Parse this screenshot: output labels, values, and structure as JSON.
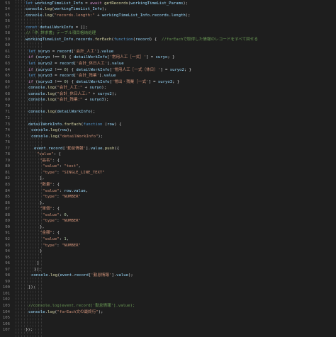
{
  "editor": {
    "background": "#1e1e1e",
    "colors": {
      "plain": "#d4d4d4",
      "keyword": "#569cd6",
      "control": "#c586c0",
      "function": "#dcdcaa",
      "variable": "#9cdcfe",
      "string": "#ce9178",
      "number": "#b5cea8",
      "comment": "#6a9955",
      "object": "#4ec9b0",
      "line_number": "#858585"
    },
    "lines": [
      {
        "n": "53",
        "indent": 4,
        "tokens": [
          [
            "kw",
            "let "
          ],
          [
            "var",
            "workingTimeList_Info"
          ],
          [
            "plain",
            " = "
          ],
          [
            "ctl",
            "await "
          ],
          [
            "fn",
            "getRecords"
          ],
          [
            "plain",
            "("
          ],
          [
            "var",
            "workingTimeList_Params"
          ],
          [
            "plain",
            ");"
          ]
        ]
      },
      {
        "n": "54",
        "indent": 4,
        "tokens": [
          [
            "var",
            "console"
          ],
          [
            "plain",
            "."
          ],
          [
            "fn",
            "log"
          ],
          [
            "plain",
            "("
          ],
          [
            "var",
            "workingTimeList_Info"
          ],
          [
            "plain",
            ");"
          ]
        ]
      },
      {
        "n": "55",
        "indent": 4,
        "tokens": [
          [
            "var",
            "console"
          ],
          [
            "plain",
            "."
          ],
          [
            "fn",
            "log"
          ],
          [
            "plain",
            "("
          ],
          [
            "str",
            "\"records.length:\""
          ],
          [
            "plain",
            " + "
          ],
          [
            "var",
            "workingTimeList_Info"
          ],
          [
            "plain",
            "."
          ],
          [
            "var",
            "records"
          ],
          [
            "plain",
            "."
          ],
          [
            "var",
            "length"
          ],
          [
            "plain",
            ");"
          ]
        ]
      },
      {
        "n": "56",
        "indent": 0,
        "tokens": []
      },
      {
        "n": "57",
        "indent": 4,
        "tokens": [
          [
            "kw",
            "const "
          ],
          [
            "var",
            "detailWorkInfo"
          ],
          [
            "plain",
            " = [];"
          ]
        ]
      },
      {
        "n": "58",
        "indent": 4,
        "tokens": [
          [
            "cmt",
            "//「作_詳求書」テーブル項目格納処理"
          ]
        ]
      },
      {
        "n": "59",
        "indent": 4,
        "tokens": [
          [
            "var",
            "workingTimeList_Info"
          ],
          [
            "plain",
            "."
          ],
          [
            "var",
            "records"
          ],
          [
            "plain",
            "."
          ],
          [
            "fn",
            "forEach"
          ],
          [
            "plain",
            "("
          ],
          [
            "kw",
            "function"
          ],
          [
            "plain",
            "("
          ],
          [
            "var",
            "record"
          ],
          [
            "plain",
            ") {  "
          ],
          [
            "cmt",
            "//forEachで取得した情報のレコードをすべて回せる"
          ]
        ]
      },
      {
        "n": "60",
        "indent": 0,
        "tokens": []
      },
      {
        "n": "61",
        "indent": 5,
        "tokens": [
          [
            "kw",
            "let "
          ],
          [
            "var",
            "suryo"
          ],
          [
            "plain",
            " = "
          ],
          [
            "var",
            "record"
          ],
          [
            "plain",
            "["
          ],
          [
            "str",
            "'会計_人工'"
          ],
          [
            "plain",
            "]."
          ],
          [
            "var",
            "value"
          ]
        ]
      },
      {
        "n": "62",
        "indent": 5,
        "tokens": [
          [
            "ctl",
            "if "
          ],
          [
            "plain",
            "("
          ],
          [
            "var",
            "suryo"
          ],
          [
            "plain",
            " !== "
          ],
          [
            "num",
            "0"
          ],
          [
            "plain",
            ") { "
          ],
          [
            "var",
            "detailWorkInfo"
          ],
          [
            "plain",
            "["
          ],
          [
            "str",
            "'常用人工［一式］'"
          ],
          [
            "plain",
            "] = "
          ],
          [
            "var",
            "suryo"
          ],
          [
            "plain",
            "; }"
          ]
        ]
      },
      {
        "n": "63",
        "indent": 5,
        "tokens": [
          [
            "kw",
            "let "
          ],
          [
            "var",
            "suryo2"
          ],
          [
            "plain",
            " = "
          ],
          [
            "var",
            "record"
          ],
          [
            "plain",
            "["
          ],
          [
            "str",
            "'会計_休日人工'"
          ],
          [
            "plain",
            "]."
          ],
          [
            "var",
            "value"
          ]
        ]
      },
      {
        "n": "64",
        "indent": 5,
        "tokens": [
          [
            "ctl",
            "if "
          ],
          [
            "plain",
            "("
          ],
          [
            "var",
            "suryo2"
          ],
          [
            "plain",
            " !== "
          ],
          [
            "num",
            "0"
          ],
          [
            "plain",
            ") { "
          ],
          [
            "var",
            "detailWorkInfo"
          ],
          [
            "plain",
            "["
          ],
          [
            "str",
            "'常用人工［一式（休日）'"
          ],
          [
            "plain",
            "] = "
          ],
          [
            "var",
            "suryo2"
          ],
          [
            "plain",
            "; }"
          ]
        ]
      },
      {
        "n": "65",
        "indent": 5,
        "tokens": [
          [
            "kw",
            "let "
          ],
          [
            "var",
            "suryo3"
          ],
          [
            "plain",
            " = "
          ],
          [
            "var",
            "record"
          ],
          [
            "plain",
            "["
          ],
          [
            "str",
            "'会計_残業'"
          ],
          [
            "plain",
            "]."
          ],
          [
            "var",
            "value"
          ]
        ]
      },
      {
        "n": "66",
        "indent": 5,
        "tokens": [
          [
            "ctl",
            "if "
          ],
          [
            "plain",
            "("
          ],
          [
            "var",
            "suryo3"
          ],
          [
            "plain",
            " !== "
          ],
          [
            "num",
            "0"
          ],
          [
            "plain",
            ") { "
          ],
          [
            "var",
            "detailWorkInfo"
          ],
          [
            "plain",
            "["
          ],
          [
            "str",
            "'常出・残業［一式'"
          ],
          [
            "plain",
            "] = "
          ],
          [
            "var",
            "suryo3"
          ],
          [
            "plain",
            "; }"
          ]
        ]
      },
      {
        "n": "67",
        "indent": 5,
        "tokens": [
          [
            "var",
            "console"
          ],
          [
            "plain",
            "."
          ],
          [
            "fn",
            "log"
          ],
          [
            "plain",
            "("
          ],
          [
            "str",
            "\"会計_人工:\""
          ],
          [
            "plain",
            " + "
          ],
          [
            "var",
            "suryo"
          ],
          [
            "plain",
            ");"
          ]
        ]
      },
      {
        "n": "68",
        "indent": 5,
        "tokens": [
          [
            "var",
            "console"
          ],
          [
            "plain",
            "."
          ],
          [
            "fn",
            "log"
          ],
          [
            "plain",
            "("
          ],
          [
            "str",
            "\"会計_休日人工:\""
          ],
          [
            "plain",
            " + "
          ],
          [
            "var",
            "suryo2"
          ],
          [
            "plain",
            ");"
          ]
        ]
      },
      {
        "n": "69",
        "indent": 5,
        "tokens": [
          [
            "var",
            "console"
          ],
          [
            "plain",
            "."
          ],
          [
            "fn",
            "log"
          ],
          [
            "plain",
            "("
          ],
          [
            "str",
            "\"会計_残業:\""
          ],
          [
            "plain",
            " + "
          ],
          [
            "var",
            "suryo3"
          ],
          [
            "plain",
            ");"
          ]
        ]
      },
      {
        "n": "70",
        "indent": 0,
        "tokens": []
      },
      {
        "n": "71",
        "indent": 5,
        "tokens": [
          [
            "var",
            "console"
          ],
          [
            "plain",
            "."
          ],
          [
            "fn",
            "log"
          ],
          [
            "plain",
            "("
          ],
          [
            "var",
            "detailWorkInfo"
          ],
          [
            "plain",
            ");"
          ]
        ]
      },
      {
        "n": "72",
        "indent": 0,
        "tokens": []
      },
      {
        "n": "73",
        "indent": 5,
        "tokens": [
          [
            "var",
            "detailWorkInfo"
          ],
          [
            "plain",
            "."
          ],
          [
            "fn",
            "forEach"
          ],
          [
            "plain",
            "("
          ],
          [
            "kw",
            "function "
          ],
          [
            "plain",
            "("
          ],
          [
            "var",
            "row"
          ],
          [
            "plain",
            ") {"
          ]
        ]
      },
      {
        "n": "74",
        "indent": 6,
        "tokens": [
          [
            "var",
            "console"
          ],
          [
            "plain",
            "."
          ],
          [
            "fn",
            "log"
          ],
          [
            "plain",
            "("
          ],
          [
            "var",
            "row"
          ],
          [
            "plain",
            ");"
          ]
        ]
      },
      {
        "n": "75",
        "indent": 6,
        "tokens": [
          [
            "var",
            "console"
          ],
          [
            "plain",
            "."
          ],
          [
            "fn",
            "log"
          ],
          [
            "plain",
            "("
          ],
          [
            "str",
            "\"detailWorkInfo\""
          ],
          [
            "plain",
            ");"
          ]
        ]
      },
      {
        "n": "76",
        "indent": 0,
        "tokens": []
      },
      {
        "n": "77",
        "indent": 7,
        "tokens": [
          [
            "var",
            "event"
          ],
          [
            "plain",
            "."
          ],
          [
            "var",
            "record"
          ],
          [
            "plain",
            "["
          ],
          [
            "str",
            "'勤怠情報'"
          ],
          [
            "plain",
            "]."
          ],
          [
            "var",
            "value"
          ],
          [
            "plain",
            "."
          ],
          [
            "fn",
            "push"
          ],
          [
            "plain",
            "({"
          ]
        ]
      },
      {
        "n": "78",
        "indent": 8,
        "tokens": [
          [
            "str",
            "\"value\""
          ],
          [
            "plain",
            ": {"
          ]
        ]
      },
      {
        "n": "79",
        "indent": 9,
        "tokens": [
          [
            "str",
            "\"品名\""
          ],
          [
            "plain",
            ": {"
          ]
        ]
      },
      {
        "n": "80",
        "indent": 10,
        "tokens": [
          [
            "str",
            "\"value\""
          ],
          [
            "plain",
            ": "
          ],
          [
            "str",
            "\"test\""
          ],
          [
            "plain",
            ","
          ]
        ]
      },
      {
        "n": "81",
        "indent": 10,
        "tokens": [
          [
            "str",
            "\"type\""
          ],
          [
            "plain",
            ": "
          ],
          [
            "str",
            "\"SINGLE_LINE_TEXT\""
          ]
        ]
      },
      {
        "n": "82",
        "indent": 9,
        "tokens": [
          [
            "plain",
            "},"
          ]
        ]
      },
      {
        "n": "83",
        "indent": 9,
        "tokens": [
          [
            "str",
            "\"数量\""
          ],
          [
            "plain",
            ": {"
          ]
        ]
      },
      {
        "n": "84",
        "indent": 10,
        "tokens": [
          [
            "str",
            "\"value\""
          ],
          [
            "plain",
            ": "
          ],
          [
            "var",
            "row"
          ],
          [
            "plain",
            "."
          ],
          [
            "var",
            "value"
          ],
          [
            "plain",
            ","
          ]
        ]
      },
      {
        "n": "85",
        "indent": 10,
        "tokens": [
          [
            "str",
            "\"type\""
          ],
          [
            "plain",
            ": "
          ],
          [
            "str",
            "\"NUMBER\""
          ]
        ]
      },
      {
        "n": "86",
        "indent": 9,
        "tokens": [
          [
            "plain",
            "},"
          ]
        ]
      },
      {
        "n": "87",
        "indent": 9,
        "tokens": [
          [
            "str",
            "\"単価\""
          ],
          [
            "plain",
            ": {"
          ]
        ]
      },
      {
        "n": "88",
        "indent": 10,
        "tokens": [
          [
            "str",
            "\"value\""
          ],
          [
            "plain",
            ": "
          ],
          [
            "num",
            "0"
          ],
          [
            "plain",
            ","
          ]
        ]
      },
      {
        "n": "89",
        "indent": 10,
        "tokens": [
          [
            "str",
            "\"type\""
          ],
          [
            "plain",
            ": "
          ],
          [
            "str",
            "\"NUMBER\""
          ]
        ]
      },
      {
        "n": "90",
        "indent": 9,
        "tokens": [
          [
            "plain",
            "},"
          ]
        ]
      },
      {
        "n": "91",
        "indent": 9,
        "tokens": [
          [
            "str",
            "\"金額\""
          ],
          [
            "plain",
            ": {"
          ]
        ]
      },
      {
        "n": "92",
        "indent": 10,
        "tokens": [
          [
            "str",
            "\"value\""
          ],
          [
            "plain",
            ": "
          ],
          [
            "num",
            "1"
          ],
          [
            "plain",
            ","
          ]
        ]
      },
      {
        "n": "93",
        "indent": 10,
        "tokens": [
          [
            "str",
            "\"type\""
          ],
          [
            "plain",
            ": "
          ],
          [
            "str",
            "\"NUMBER\""
          ]
        ]
      },
      {
        "n": "94",
        "indent": 9,
        "tokens": [
          [
            "plain",
            "}"
          ]
        ]
      },
      {
        "n": "95",
        "indent": 0,
        "tokens": []
      },
      {
        "n": "96",
        "indent": 8,
        "tokens": [
          [
            "plain",
            "}"
          ]
        ]
      },
      {
        "n": "97",
        "indent": 7,
        "tokens": [
          [
            "plain",
            "});"
          ]
        ]
      },
      {
        "n": "98",
        "indent": 6,
        "tokens": [
          [
            "var",
            "console"
          ],
          [
            "plain",
            "."
          ],
          [
            "fn",
            "log"
          ],
          [
            "plain",
            "("
          ],
          [
            "var",
            "event"
          ],
          [
            "plain",
            "."
          ],
          [
            "var",
            "record"
          ],
          [
            "plain",
            "["
          ],
          [
            "str",
            "'勤怠情報'"
          ],
          [
            "plain",
            "]."
          ],
          [
            "var",
            "value"
          ],
          [
            "plain",
            ");"
          ]
        ]
      },
      {
        "n": "99",
        "indent": 0,
        "tokens": []
      },
      {
        "n": "100",
        "indent": 5,
        "tokens": [
          [
            "plain",
            "});"
          ]
        ]
      },
      {
        "n": "101",
        "indent": 0,
        "tokens": []
      },
      {
        "n": "102",
        "indent": 0,
        "tokens": []
      },
      {
        "n": "103",
        "indent": 5,
        "tokens": [
          [
            "cmt",
            "//console.log(event.record['勤怠情報'].value);"
          ]
        ]
      },
      {
        "n": "104",
        "indent": 5,
        "tokens": [
          [
            "var",
            "console"
          ],
          [
            "plain",
            "."
          ],
          [
            "fn",
            "log"
          ],
          [
            "plain",
            "("
          ],
          [
            "str",
            "\"forEach文の最終行\""
          ],
          [
            "plain",
            ");"
          ]
        ]
      },
      {
        "n": "105",
        "indent": 0,
        "tokens": []
      },
      {
        "n": "106",
        "indent": 0,
        "tokens": []
      },
      {
        "n": "107",
        "indent": 4,
        "tokens": [
          [
            "plain",
            "});"
          ]
        ]
      }
    ]
  }
}
